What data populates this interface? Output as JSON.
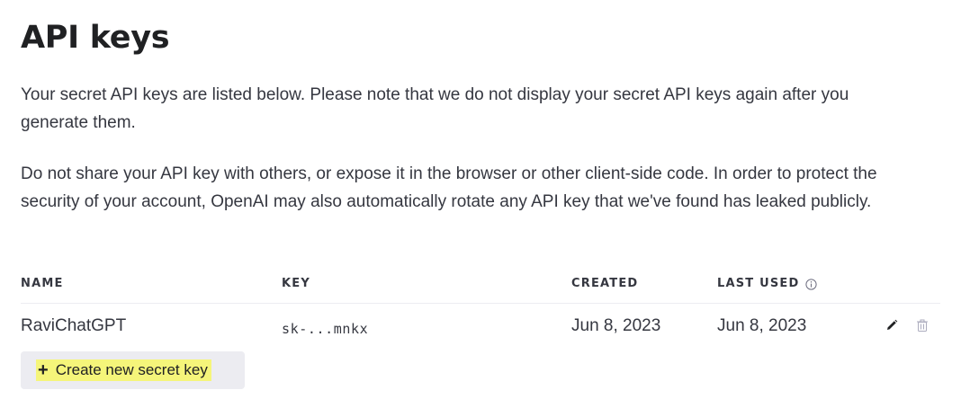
{
  "page": {
    "title": "API keys",
    "paragraphs": [
      "Your secret API keys are listed below. Please note that we do not display your secret API keys again after you generate them.",
      "Do not share your API key with others, or expose it in the browser or other client-side code. In order to protect the security of your account, OpenAI may also automatically rotate any API key that we've found has leaked publicly."
    ]
  },
  "table": {
    "columns": {
      "name": "NAME",
      "key": "KEY",
      "created": "CREATED",
      "last_used": "LAST USED"
    },
    "rows": [
      {
        "name": "RaviChatGPT",
        "key": "sk-...mnkx",
        "created": "Jun 8, 2023",
        "last_used": "Jun 8, 2023"
      }
    ],
    "row_actions": [
      "pencil-icon",
      "trash-icon"
    ],
    "header_icon": "info-icon"
  },
  "create_button": {
    "icon": "+",
    "label": "Create new secret key",
    "highlight_color": "#f5f57a"
  },
  "colors": {
    "text": "#353740",
    "heading": "#202123",
    "button_bg": "#ececf1",
    "divider": "#ececf1"
  }
}
